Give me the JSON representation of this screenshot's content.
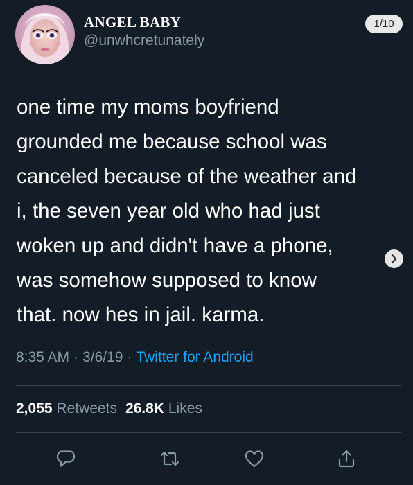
{
  "author": {
    "name": "ANGEL BABY",
    "handle": "@unwhcretunately"
  },
  "page_indicator": "1/10",
  "tweet": {
    "lines": [
      "one time my moms boyfriend",
      "grounded me because school was",
      "canceled because of the weather and",
      "i, the seven year old who had just",
      "woken up and didn't have a phone,",
      "was somehow supposed to know",
      "that. now hes in jail. karma."
    ],
    "time": "8:35 AM",
    "date": "3/6/19",
    "separator": "·",
    "source": "Twitter for Android"
  },
  "stats": {
    "retweets_count": "2,055",
    "retweets_label": "Retweets",
    "likes_count": "26.8K",
    "likes_label": "Likes"
  },
  "icons": {
    "reply": "reply-icon",
    "retweet": "retweet-icon",
    "like": "heart-icon",
    "share": "share-icon",
    "next": "chevron-right-icon"
  },
  "colors": {
    "background": "#15202b",
    "text": "#ffffff",
    "secondary_text": "#8899a6",
    "link": "#1da1f2",
    "divider": "#38444d"
  }
}
